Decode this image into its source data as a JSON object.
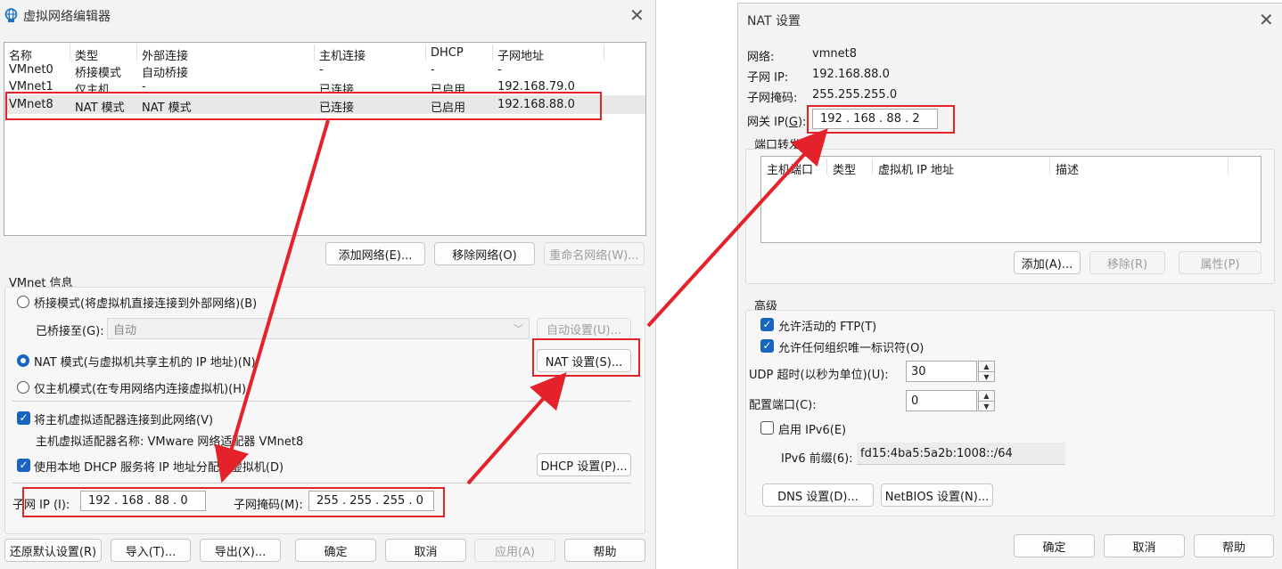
{
  "vne": {
    "title": "虚拟网络编辑器",
    "columns": [
      "名称",
      "类型",
      "外部连接",
      "主机连接",
      "DHCP",
      "子网地址"
    ],
    "rows": [
      [
        "VMnet0",
        "桥接模式",
        "自动桥接",
        "-",
        "-",
        "-"
      ],
      [
        "VMnet1",
        "仅主机",
        "-",
        "已连接",
        "已启用",
        "192.168.79.0"
      ],
      [
        "VMnet8",
        "NAT 模式",
        "NAT 模式",
        "已连接",
        "已启用",
        "192.168.88.0"
      ]
    ],
    "add_network": "添加网络(E)...",
    "remove_network": "移除网络(O)",
    "rename_network": "重命名网络(W)...",
    "vmnet_info": "VMnet 信息",
    "bridged_mode": "桥接模式(将虚拟机直接连接到外部网络)(B)",
    "bridged_to_label": "已桥接至(G):",
    "bridged_to_value": "自动",
    "auto_settings": "自动设置(U)...",
    "nat_mode": "NAT 模式(与虚拟机共享主机的 IP 地址)(N)",
    "nat_settings": "NAT 设置(S)...",
    "host_only_mode": "仅主机模式(在专用网络内连接虚拟机)(H)",
    "connect_adapter": "将主机虚拟适配器连接到此网络(V)",
    "adapter_name": "主机虚拟适配器名称: VMware 网络适配器 VMnet8",
    "use_dhcp": "使用本地 DHCP 服务将 IP 地址分配给虚拟机(D)",
    "dhcp_settings": "DHCP 设置(P)...",
    "subnet_ip_label": "子网 IP (I):",
    "subnet_ip_value": "192 . 168 . 88 .  0",
    "subnet_mask_label": "子网掩码(M):",
    "subnet_mask_value": "255 . 255 . 255 .  0",
    "restore_defaults": "还原默认设置(R)",
    "import": "导入(T)...",
    "export": "导出(X)...",
    "ok": "确定",
    "cancel": "取消",
    "apply": "应用(A)",
    "help": "帮助"
  },
  "nat": {
    "title": "NAT 设置",
    "network_label": "网络:",
    "network_value": "vmnet8",
    "subnet_ip_label": "子网 IP:",
    "subnet_ip_value": "192.168.88.0",
    "subnet_mask_label": "子网掩码:",
    "subnet_mask_value": "255.255.255.0",
    "gateway_label_prefix": "网关 IP(",
    "gateway_label_key": "G",
    "gateway_label_suffix": "):",
    "gateway_value": "192 . 168 . 88 .  2",
    "port_forwarding": "端口转发(F)",
    "pf_columns": [
      "主机端口",
      "类型",
      "虚拟机 IP 地址",
      "描述"
    ],
    "pf_add": "添加(A)...",
    "pf_remove": "移除(R)",
    "pf_properties": "属性(P)",
    "advanced": "高级",
    "allow_ftp": "允许活动的 FTP(T)",
    "allow_any_oui": "允许任何组织唯一标识符(O)",
    "udp_timeout_label": "UDP 超时(以秒为单位)(U):",
    "udp_timeout_value": "30",
    "config_port_label": "配置端口(C):",
    "config_port_value": "0",
    "enable_ipv6": "启用 IPv6(E)",
    "ipv6_prefix_label": "IPv6 前缀(6):",
    "ipv6_prefix_value": "fd15:4ba5:5a2b:1008::/64",
    "dns_settings": "DNS 设置(D)...",
    "netbios_settings": "NetBIOS 设置(N)...",
    "ok": "确定",
    "cancel": "取消",
    "help": "帮助"
  },
  "annotation_color": "#e3222a",
  "accent_color": "#1765c0",
  "icons": {
    "app": "globe-network-icon",
    "close": "close-icon",
    "spin_up": "spin-up-icon",
    "spin_down": "spin-down-icon",
    "dropdown": "chevron-down-icon"
  }
}
